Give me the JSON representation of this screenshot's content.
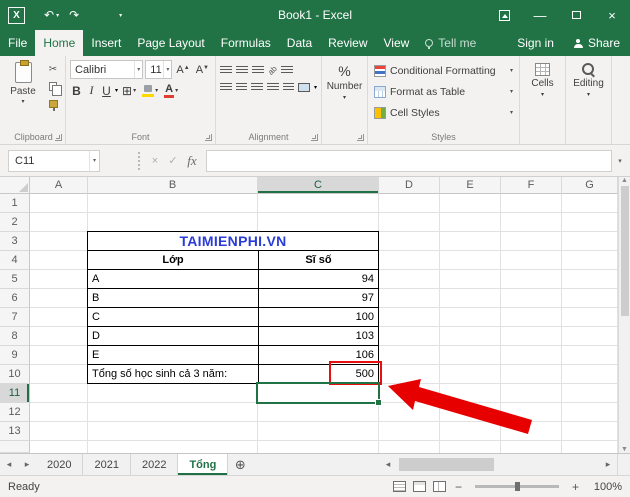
{
  "window": {
    "title": "Book1 - Excel"
  },
  "icons": {
    "caret": "▾",
    "undo": "↶",
    "redo": "↷",
    "cut": "✂",
    "borders": "⊞",
    "grow_font": "A",
    "shrink_font": "A",
    "font_color_letter": "A",
    "orientation": "ab",
    "check": "✓",
    "cancel": "×",
    "left": "◂",
    "right": "▸",
    "up": "▲",
    "down": "▼",
    "plus": "⊕",
    "minus_zoom": "−",
    "plus_zoom": "+",
    "minimize": "—",
    "close": "×",
    "logo_letter": "X"
  },
  "ribbon_tabs": {
    "file": "File",
    "home": "Home",
    "insert": "Insert",
    "page_layout": "Page Layout",
    "formulas": "Formulas",
    "data": "Data",
    "review": "Review",
    "view": "View",
    "tell_me": "Tell me",
    "sign_in": "Sign in",
    "share": "Share"
  },
  "ribbon": {
    "paste": "Paste",
    "clipboard_label": "Clipboard",
    "font_name": "Calibri",
    "font_size": "11",
    "bold": "B",
    "italic": "I",
    "underline": "U",
    "font_label": "Font",
    "alignment_label": "Alignment",
    "percent": "%",
    "number_label": "Number",
    "conditional_formatting": "Conditional Formatting",
    "format_as_table": "Format as Table",
    "cell_styles": "Cell Styles",
    "styles_label": "Styles",
    "cells_label": "Cells",
    "editing_label": "Editing"
  },
  "formula_bar": {
    "name_box": "C11",
    "fx": "fx",
    "formula": ""
  },
  "sheet": {
    "columns": [
      "A",
      "B",
      "C",
      "D",
      "E",
      "F",
      "G"
    ],
    "rows": [
      "1",
      "2",
      "3",
      "4",
      "5",
      "6",
      "7",
      "8",
      "9",
      "10",
      "11",
      "12",
      "13"
    ],
    "banner": "TAIMIENPHI.VN",
    "selected_cell": "C11",
    "table": {
      "headers": [
        "Lớp",
        "Sĩ số"
      ],
      "rows": [
        [
          "A",
          "94"
        ],
        [
          "B",
          "97"
        ],
        [
          "C",
          "100"
        ],
        [
          "D",
          "103"
        ],
        [
          "E",
          "106"
        ]
      ],
      "total_label": "Tổng số học sinh cả 3 năm:",
      "total_value": "500"
    }
  },
  "sheet_tabs": {
    "items": [
      "2020",
      "2021",
      "2022",
      "Tổng"
    ]
  },
  "status_bar": {
    "ready": "Ready",
    "zoom_level": "100%"
  }
}
